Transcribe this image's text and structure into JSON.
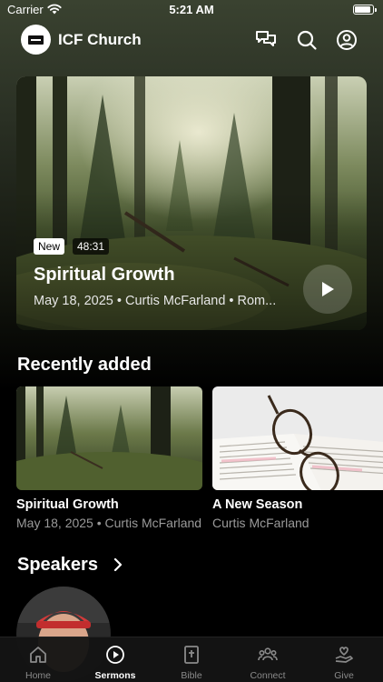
{
  "status": {
    "carrier": "Carrier",
    "time": "5:21 AM"
  },
  "header": {
    "title": "ICF Church"
  },
  "hero": {
    "badge_new": "New",
    "duration": "48:31",
    "title": "Spiritual Growth",
    "meta": "May 18, 2025 • Curtis McFarland  • Rom..."
  },
  "recent": {
    "title": "Recently added",
    "items": [
      {
        "title": "Spiritual Growth",
        "subtitle": "May 18, 2025 • Curtis McFarland"
      },
      {
        "title": "A New Season",
        "subtitle": "Curtis McFarland"
      }
    ]
  },
  "speakers": {
    "title": "Speakers"
  },
  "tabs": [
    {
      "label": "Home"
    },
    {
      "label": "Sermons"
    },
    {
      "label": "Bible"
    },
    {
      "label": "Connect"
    },
    {
      "label": "Give"
    }
  ],
  "active_tab": "Sermons",
  "icons": {
    "header": [
      "chat-icon",
      "search-icon",
      "account-icon"
    ],
    "tabs": [
      "home-icon",
      "play-circle-icon",
      "bible-icon",
      "people-icon",
      "hand-heart-icon"
    ]
  }
}
